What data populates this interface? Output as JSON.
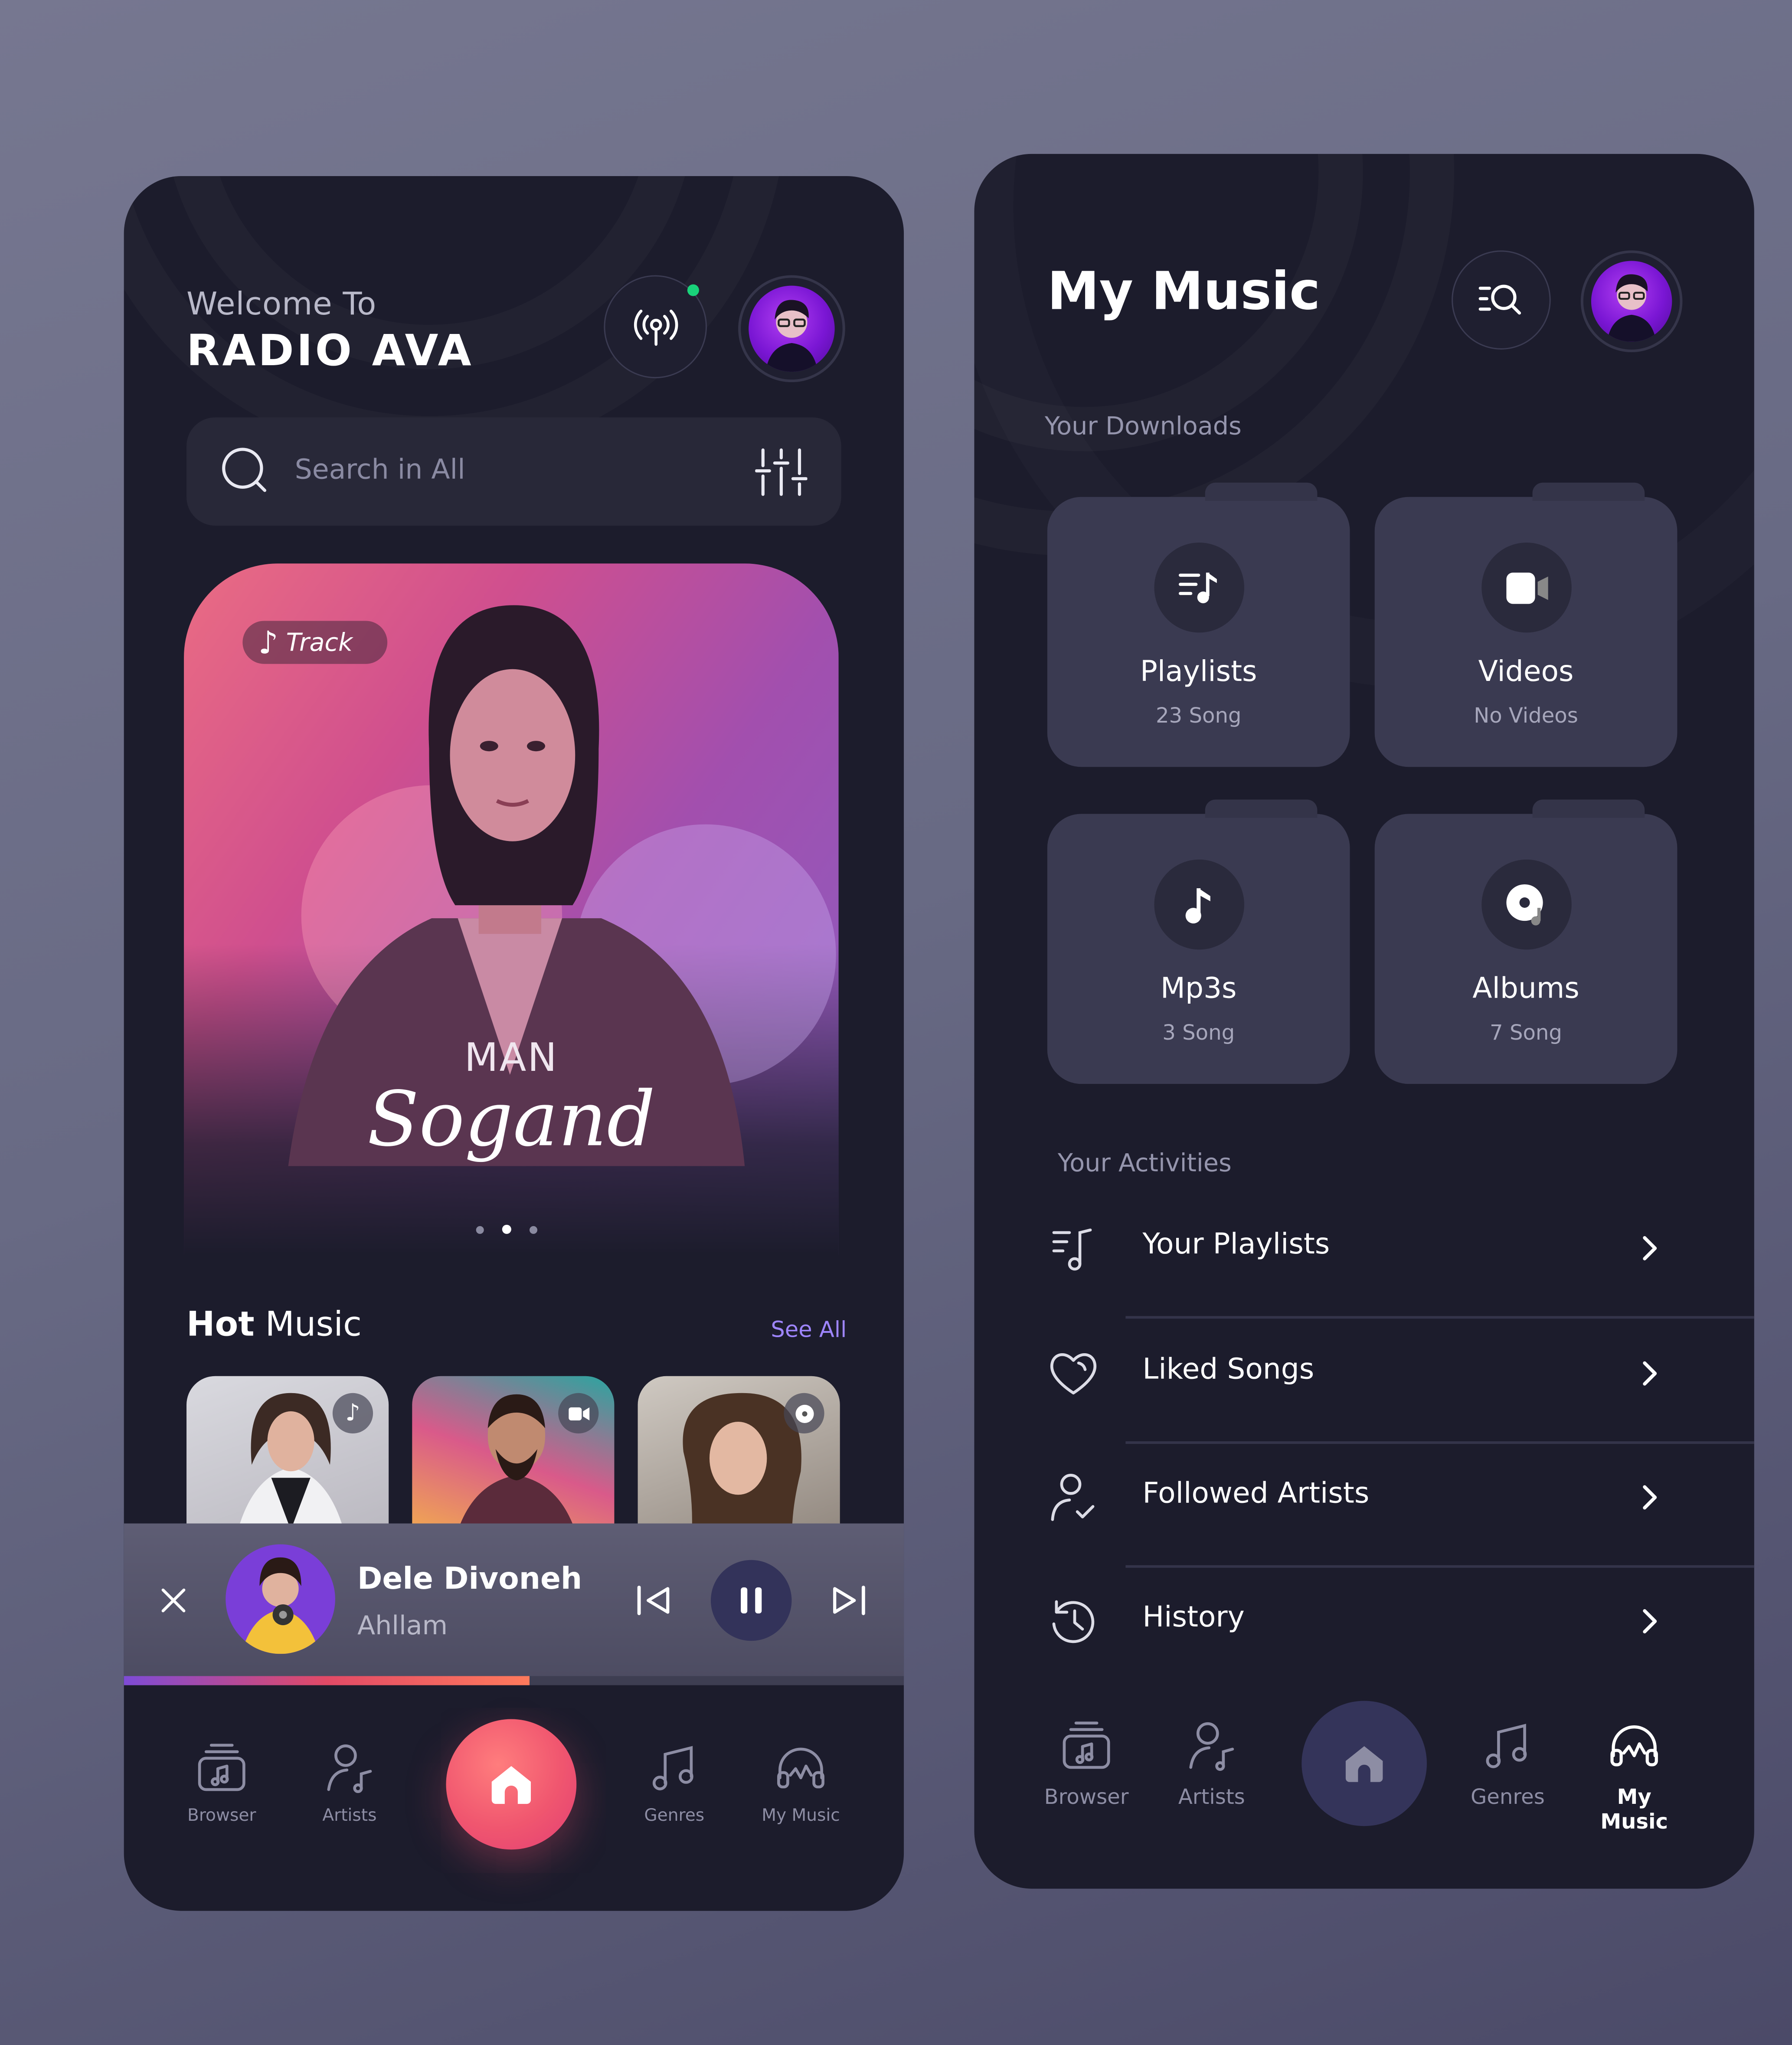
{
  "left_screen": {
    "welcome": "Welcome To",
    "brand": "RADIO AVA",
    "search": {
      "placeholder": "Search in All"
    },
    "hero": {
      "badge": "Track",
      "subtitle": "MAN",
      "title": "Sogand",
      "pages": 3,
      "active_page": 2
    },
    "hot_music": {
      "title_bold": "Hot",
      "title_rest": " Music",
      "see_all": "See All"
    },
    "now_playing": {
      "song": "Dele Divoneh",
      "artist": "Ahllam",
      "progress": 0.52
    },
    "nav": {
      "items": [
        "Browser",
        "Artists",
        "Genres",
        "My Music"
      ]
    }
  },
  "right_screen": {
    "title": "My Music",
    "downloads_label": "Your Downloads",
    "downloads": [
      {
        "title": "Playlists",
        "sub": "23 Song",
        "icon": "playlist-icon"
      },
      {
        "title": "Videos",
        "sub": "No Videos",
        "icon": "video-icon"
      },
      {
        "title": "Mp3s",
        "sub": "3 Song",
        "icon": "music-note-icon"
      },
      {
        "title": "Albums",
        "sub": "7 Song",
        "icon": "album-icon"
      }
    ],
    "activities_label": "Your Activities",
    "activities": [
      {
        "label": "Your Playlists",
        "icon": "playlist-icon"
      },
      {
        "label": "Liked Songs",
        "icon": "heart-icon"
      },
      {
        "label": "Followed Artists",
        "icon": "user-check-icon"
      },
      {
        "label": "History",
        "icon": "history-icon"
      }
    ],
    "nav": {
      "items": [
        "Browser",
        "Artists",
        "Genres",
        "My Music"
      ],
      "active": "My Music"
    }
  },
  "colors": {
    "background": "#6c6d86",
    "card": "#1c1c2c",
    "accent_purple": "#9e85ff",
    "home_gradient_start": "#ff6f6f",
    "home_gradient_end": "#e83f79",
    "live_dot": "#19d27a"
  }
}
